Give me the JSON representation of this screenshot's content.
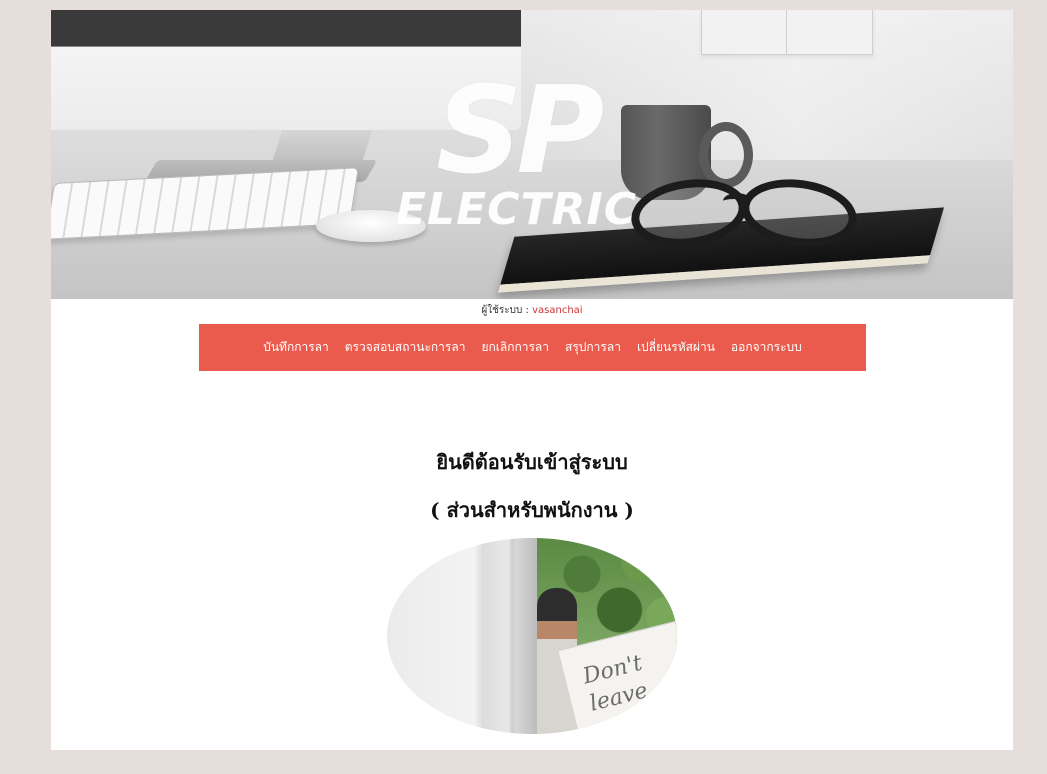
{
  "banner": {
    "logo_mark": "SP",
    "logo_text": "ELECTRIC"
  },
  "user": {
    "label": "ผู้ใช้ระบบ :",
    "name": "vasanchai"
  },
  "nav": {
    "items": [
      {
        "label": "บันทึกการลา"
      },
      {
        "label": "ตรวจสอบสถานะการลา"
      },
      {
        "label": "ยกเลิกการลา"
      },
      {
        "label": "สรุปการลา"
      },
      {
        "label": "เปลี่ยนรหัสผ่าน"
      },
      {
        "label": "ออกจากระบบ"
      }
    ]
  },
  "main": {
    "welcome": "ยินดีต้อนรับเข้าสู่ระบบ",
    "subtitle": "( ส่วนสำหรับพนักงาน )",
    "photo_sign_text": "Don't leave"
  },
  "colors": {
    "nav_bg": "#ea5b4d",
    "page_bg": "#e6dedb",
    "username": "#cc3333"
  }
}
